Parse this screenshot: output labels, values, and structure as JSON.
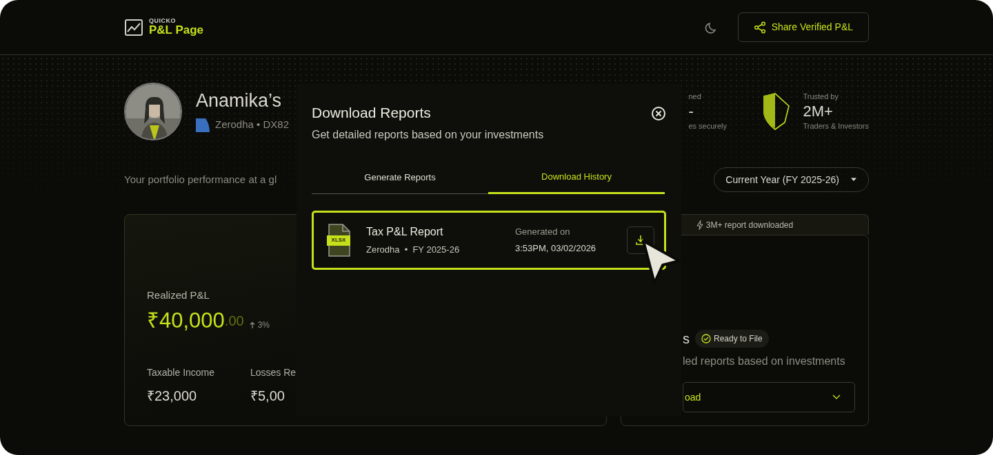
{
  "header": {
    "logo": {
      "kicker": "QUICKO",
      "name": "P&L Page"
    },
    "share_button": "Share Verified P&L"
  },
  "profile": {
    "name": "Anamika’s",
    "broker": "Zerodha • DX82"
  },
  "stats": [
    {
      "label": "ned",
      "value": "-",
      "caption": "es securely"
    },
    {
      "kind": "shield",
      "label": "Trusted by",
      "value": "2M+",
      "caption": "Traders & Investors"
    }
  ],
  "tagline": "Your portfolio performance at a gl",
  "period_select": "Current Year (FY 2025-26)",
  "pnl_card": {
    "label": "Realized P&L",
    "amount": "₹40,000",
    "decimals": ".00",
    "change": "3%",
    "metrics": [
      {
        "label": "Taxable Income",
        "value": "₹23,000"
      },
      {
        "label": "Losses Re",
        "value": "₹5,00"
      }
    ]
  },
  "reports_card": {
    "banner": "3M+ report downloaded",
    "title": "s",
    "badge": "Ready to File",
    "description": "led reports based on investments",
    "select": "oad"
  },
  "modal": {
    "title": "Download Reports",
    "subtitle": "Get detailed reports based on your investments",
    "tabs": [
      {
        "label": "Generate Reports",
        "selected": false
      },
      {
        "label": "Download History",
        "selected": true
      }
    ],
    "reports": [
      {
        "file_type": "XLSX",
        "title": "Tax P&L Report",
        "meta": "Zerodha  •  FY 2025-26",
        "generated_label": "Generated on",
        "generated_at": "3:53PM, 03/02/2026"
      }
    ]
  }
}
